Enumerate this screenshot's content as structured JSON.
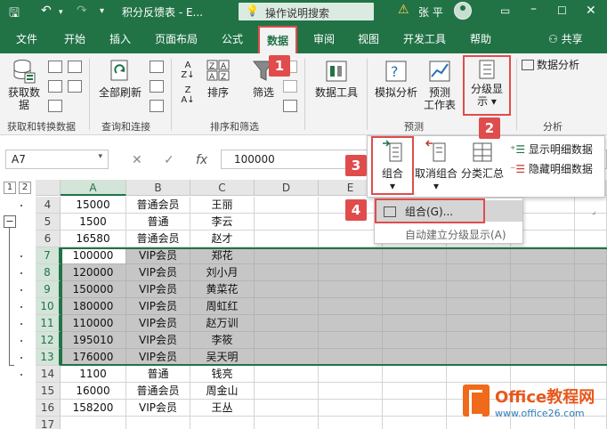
{
  "title_bar": {
    "doc_title": "积分反馈表 - E...",
    "tell_me": "操作说明搜索",
    "username": "张 平"
  },
  "tabs": [
    {
      "label": "文件"
    },
    {
      "label": "开始"
    },
    {
      "label": "插入"
    },
    {
      "label": "页面布局"
    },
    {
      "label": "公式"
    },
    {
      "label": "数据"
    },
    {
      "label": "审阅"
    },
    {
      "label": "视图"
    },
    {
      "label": "开发工具"
    },
    {
      "label": "帮助"
    }
  ],
  "share_label": "共享",
  "ribbon": {
    "get_data": "获取数据",
    "refresh_all": "全部刷新",
    "sort": "排序",
    "filter": "筛选",
    "data_tools": "数据工具",
    "what_if": "模拟分析",
    "forecast_sheet_l1": "预测",
    "forecast_sheet_l2": "工作表",
    "outline_l1": "分级显",
    "outline_l2": "示",
    "data_analysis": "数据分析",
    "groups": {
      "get_transform": "获取和转换数据",
      "queries": "查询和连接",
      "sort_filter": "排序和筛选",
      "forecast": "预测",
      "analysis": "分析"
    }
  },
  "formula_bar": {
    "name_box": "A7",
    "fx": "fx",
    "value": "100000"
  },
  "outline_levels": [
    "1",
    "2"
  ],
  "columns": [
    "A",
    "B",
    "C",
    "D",
    "E"
  ],
  "rows": [
    {
      "num": "4",
      "a": "15000",
      "b": "普通会员",
      "c": "王丽",
      "selected": false
    },
    {
      "num": "5",
      "a": "1500",
      "b": "普通",
      "c": "李云",
      "selected": false
    },
    {
      "num": "6",
      "a": "16580",
      "b": "普通会员",
      "c": "赵才",
      "selected": false
    },
    {
      "num": "7",
      "a": "100000",
      "b": "VIP会员",
      "c": "郑花",
      "selected": true
    },
    {
      "num": "8",
      "a": "120000",
      "b": "VIP会员",
      "c": "刘小月",
      "selected": true
    },
    {
      "num": "9",
      "a": "150000",
      "b": "VIP会员",
      "c": "黄菜花",
      "selected": true
    },
    {
      "num": "10",
      "a": "180000",
      "b": "VIP会员",
      "c": "周虹红",
      "selected": true
    },
    {
      "num": "11",
      "a": "110000",
      "b": "VIP会员",
      "c": "赵万训",
      "selected": true
    },
    {
      "num": "12",
      "a": "195010",
      "b": "VIP会员",
      "c": "李筱",
      "selected": true
    },
    {
      "num": "13",
      "a": "176000",
      "b": "VIP会员",
      "c": "吴天明",
      "selected": true
    },
    {
      "num": "14",
      "a": "1100",
      "b": "普通",
      "c": "钱亮",
      "selected": false
    },
    {
      "num": "15",
      "a": "16000",
      "b": "普通会员",
      "c": "周金山",
      "selected": false
    },
    {
      "num": "16",
      "a": "158200",
      "b": "VIP会员",
      "c": "王丛",
      "selected": false
    },
    {
      "num": "17",
      "a": "",
      "b": "",
      "c": "",
      "selected": false
    }
  ],
  "outline_menu": {
    "group": "组合",
    "ungroup": "取消组合",
    "subtotal": "分类汇总",
    "show_detail": "显示明细数据",
    "hide_detail": "隐藏明细数据"
  },
  "group_menu": {
    "group_item": "组合(G)...",
    "auto_outline": "自动建立分级显示(A)"
  },
  "badges": [
    "1",
    "2",
    "3",
    "4"
  ],
  "watermark": {
    "brand": "Office教程网",
    "url": "www.office26.com"
  },
  "colors": {
    "excel_green": "#217346",
    "highlight_red": "#e04c4c",
    "selection_gray": "#c6c6c6"
  }
}
